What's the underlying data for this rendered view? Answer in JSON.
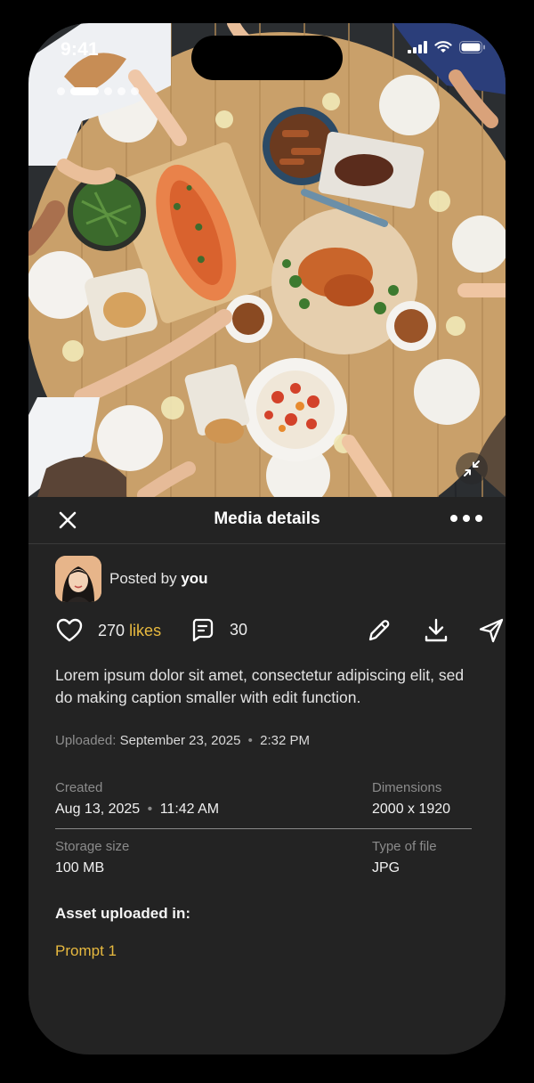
{
  "status_bar": {
    "time": "9:41"
  },
  "header": {
    "title": "Media details"
  },
  "poster": {
    "prefix": "Posted by",
    "name": "you"
  },
  "actions": {
    "likes_count": "270",
    "likes_label": "likes",
    "comments_count": "30"
  },
  "caption": "Lorem ipsum dolor sit amet, consectetur adipiscing elit, sed do making caption smaller with edit function.",
  "uploaded": {
    "label": "Uploaded:",
    "date": "September 23, 2025",
    "separator": "•",
    "time": "2:32 PM"
  },
  "details": {
    "created_label": "Created",
    "created_date": "Aug 13, 2025",
    "created_sep": "•",
    "created_time": "11:42 AM",
    "dimensions_label": "Dimensions",
    "dimensions_value": "2000 x 1920",
    "storage_label": "Storage size",
    "storage_value": "100 MB",
    "filetype_label": "Type of file",
    "filetype_value": "JPG"
  },
  "asset": {
    "heading": "Asset uploaded in:",
    "link": "Prompt 1"
  },
  "colors": {
    "accent": "#E7B93F",
    "surface": "#232323",
    "background": "#000000"
  },
  "icons": [
    "close-icon",
    "more-icon",
    "heart-icon",
    "comment-icon",
    "pencil-icon",
    "download-icon",
    "send-icon",
    "collapse-icon"
  ]
}
